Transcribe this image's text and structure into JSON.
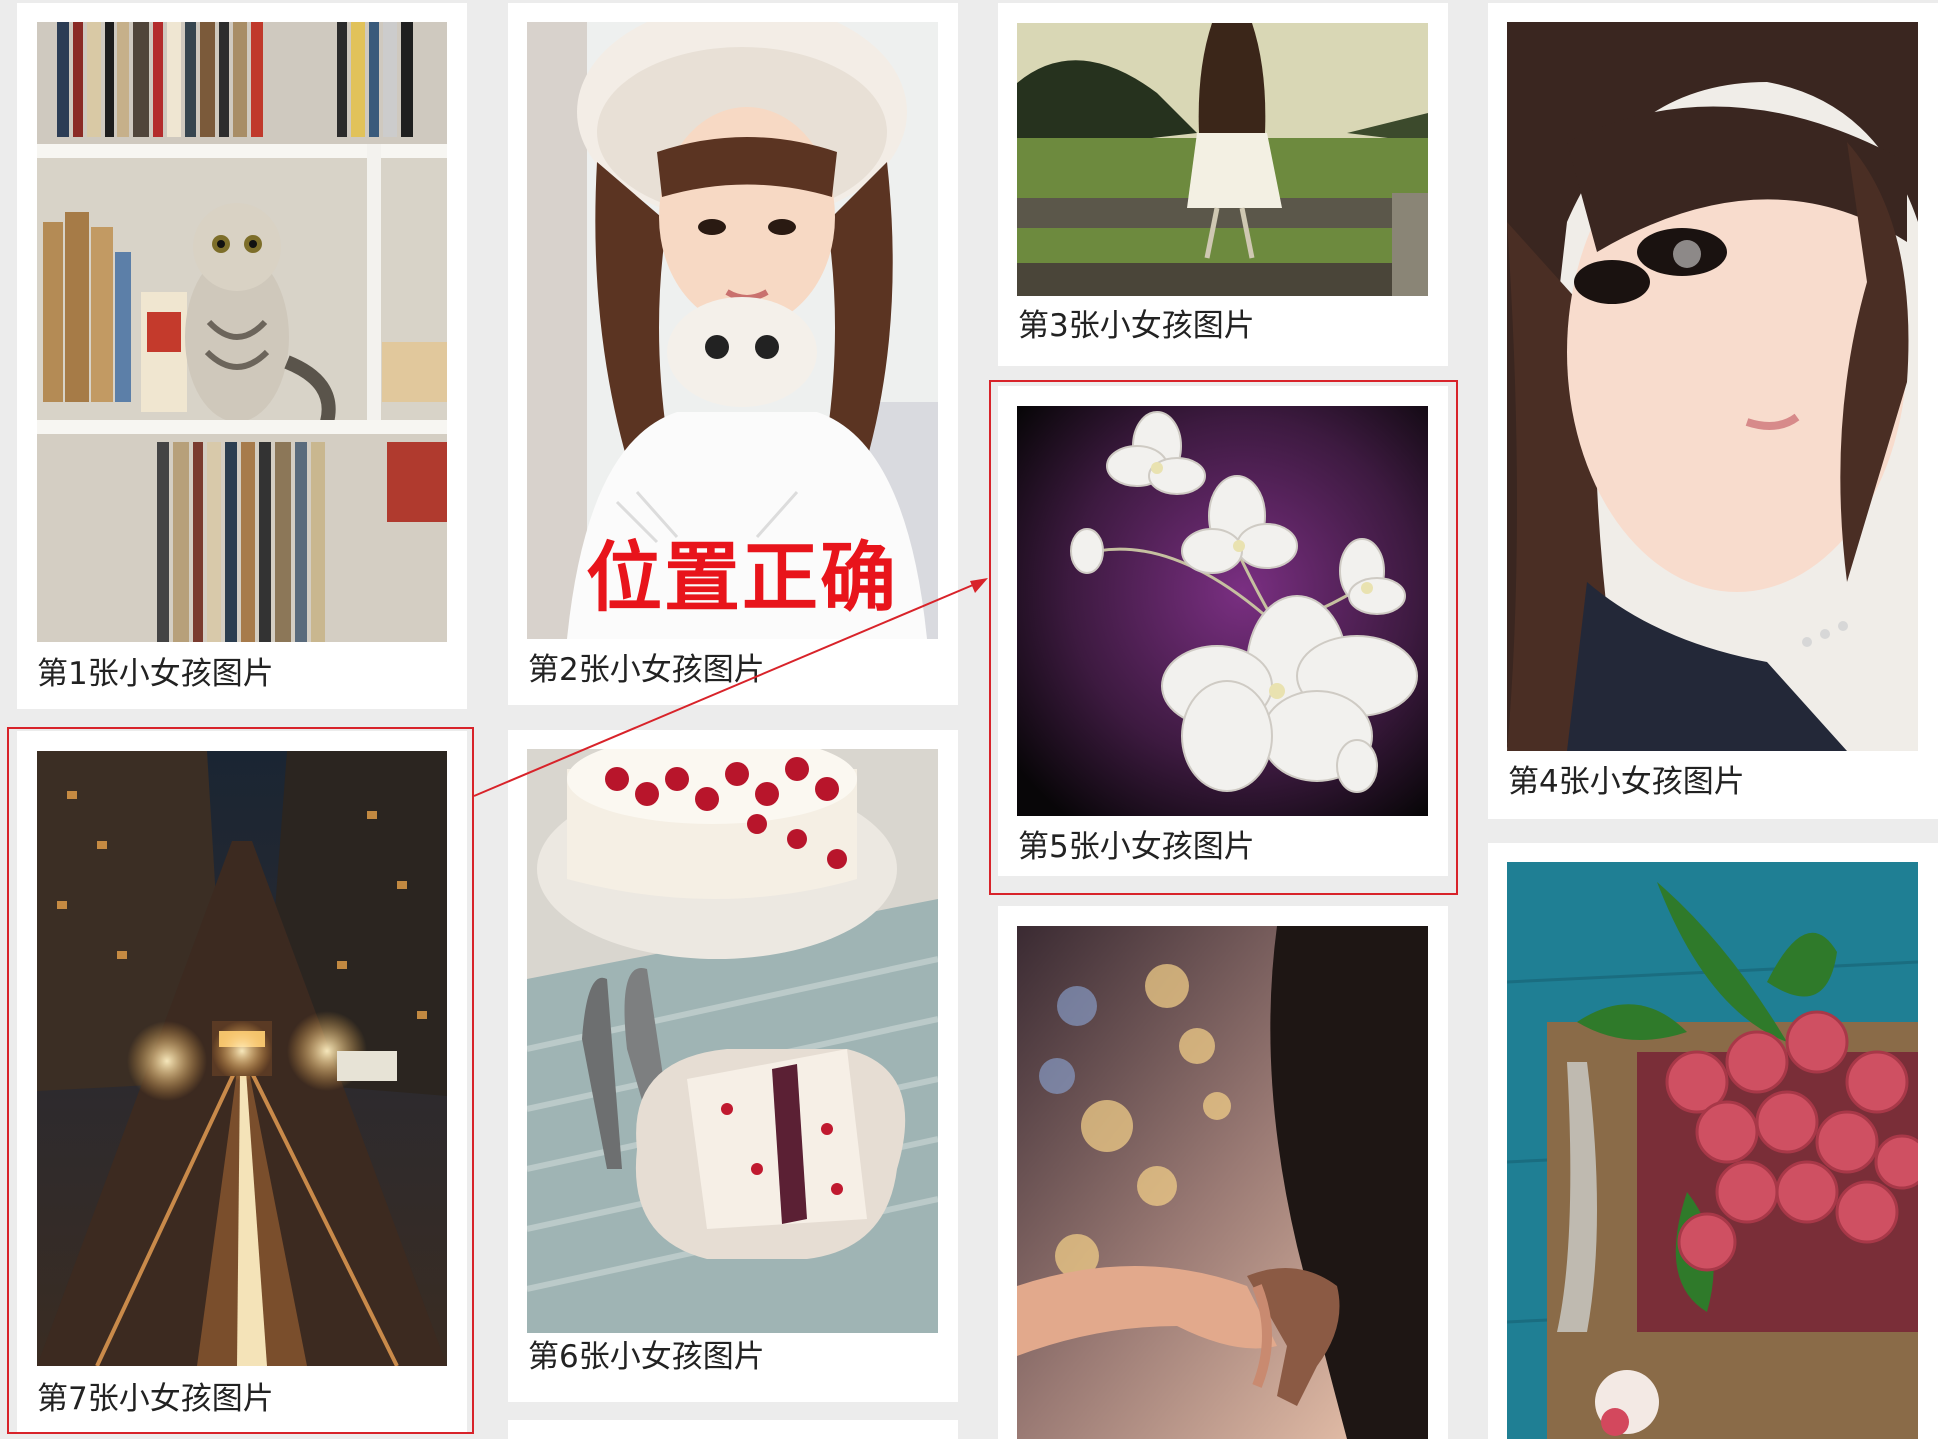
{
  "cards": [
    {
      "id": 1,
      "caption": "第1张小女孩图片",
      "image": "cat on bookshelf"
    },
    {
      "id": 2,
      "caption": "第2张小女孩图片",
      "image": "girl in white fur hat with headphones"
    },
    {
      "id": 3,
      "caption": "第3张小女孩图片",
      "image": "girl sitting on fence facing field"
    },
    {
      "id": 4,
      "caption": "第4张小女孩图片",
      "image": "girl portrait selfie"
    },
    {
      "id": 5,
      "caption": "第5张小女孩图片",
      "image": "white hydrangea flowers on purple"
    },
    {
      "id": 6,
      "caption": "第6张小女孩图片",
      "image": "cake slices with berries"
    },
    {
      "id": 7,
      "caption": "第7张小女孩图片",
      "image": "city street with cable car at night"
    },
    {
      "id": 8,
      "caption": "",
      "image": "two people holding hands"
    },
    {
      "id": 9,
      "caption": "",
      "image": "lychees on wooden tray"
    }
  ],
  "annotation": {
    "label": "位置正确",
    "color": "#e8141b"
  },
  "colors": {
    "background": "#ececec",
    "card": "#ffffff",
    "highlight": "#d8232a"
  }
}
